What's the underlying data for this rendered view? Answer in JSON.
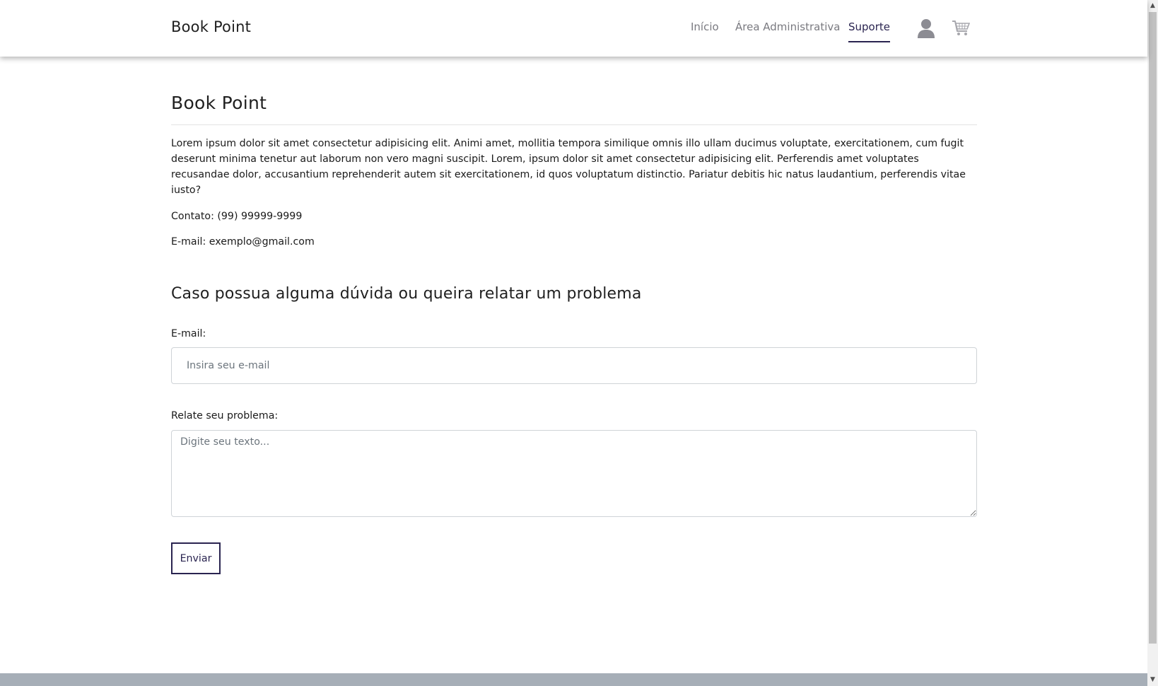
{
  "header": {
    "brand": "Book Point",
    "nav": [
      {
        "label": "Início",
        "active": false
      },
      {
        "label": "Área Administrativa",
        "active": false
      },
      {
        "label": "Suporte",
        "active": true
      }
    ],
    "icons": [
      "user-icon",
      "cart-icon"
    ],
    "active_color": "#2a2450"
  },
  "main": {
    "title": "Book Point",
    "intro": "Lorem ipsum dolor sit amet consectetur adipisicing elit. Animi amet, mollitia tempora similique omnis illo ullam ducimus voluptate, exercitationem, cum fugit deserunt minima tenetur aut laborum non vero magni suscipit. Lorem, ipsum dolor sit amet consectetur adipisicing elit. Perferendis amet voluptates recusandae dolor, accusantium reprehenderit autem sit exercitationem, id quos voluptatum distinctio. Pariatur debitis hic natus laudantium, perferendis vitae iusto?",
    "contact": "Contato: (99) 99999-9999",
    "email": "E-mail: exemplo@gmail.com"
  },
  "form": {
    "heading": "Caso possua alguma dúvida ou queira relatar um problema",
    "email_label": "E-mail:",
    "email_placeholder": "Insira seu e-mail",
    "email_value": "",
    "problem_label": "Relate seu problema:",
    "problem_placeholder": "Digite seu texto...",
    "problem_value": "",
    "submit_label": "Enviar"
  },
  "colors": {
    "footer": "#a6aeb7",
    "accent": "#2a2450"
  }
}
